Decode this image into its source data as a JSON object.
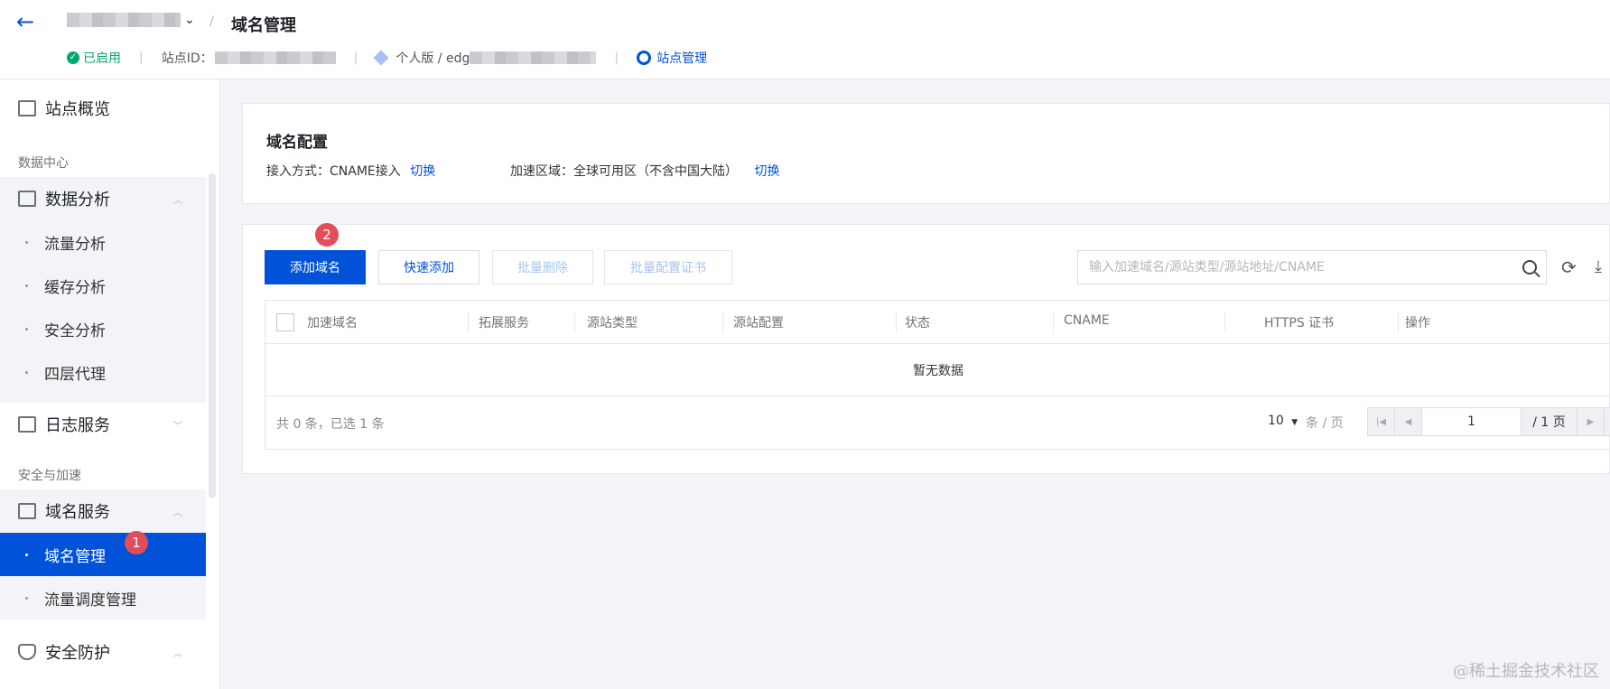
{
  "header": {
    "page_title": "域名管理",
    "breadcrumb_sep": "/",
    "status": "已启用",
    "site_id_label": "站点ID：",
    "edition": "个人版 / edg",
    "site_manage": "站点管理"
  },
  "sidebar": {
    "overview": "站点概览",
    "group_data": "数据中心",
    "data_analysis": "数据分析",
    "sub_data": [
      "流量分析",
      "缓存分析",
      "安全分析",
      "四层代理"
    ],
    "log_service": "日志服务",
    "group_security": "安全与加速",
    "domain_service": "域名服务",
    "sub_domain": [
      "域名管理",
      "流量调度管理"
    ],
    "security": "安全防护",
    "badge_1": "1"
  },
  "config": {
    "title": "域名配置",
    "access_label": "接入方式：CNAME接入",
    "access_switch": "切换",
    "region_label": "加速区域：全球可用区（不含中国大陆）",
    "region_switch": "切换"
  },
  "toolbar": {
    "add_domain": "添加域名",
    "quick_add": "快速添加",
    "batch_delete": "批量删除",
    "batch_cert": "批量配置证书",
    "search_placeholder": "输入加速域名/源站类型/源站地址/CNAME",
    "badge_2": "2"
  },
  "table": {
    "columns": [
      "加速域名",
      "拓展服务",
      "源站类型",
      "源站配置",
      "状态",
      "CNAME",
      "HTTPS 证书",
      "操作"
    ],
    "empty_text": "暂无数据"
  },
  "footer": {
    "total": "共 0 条，已选 1 条",
    "page_size": "10",
    "page_size_unit": "条 / 页",
    "current_page": "1",
    "total_pages": "/ 1 页"
  },
  "watermark": "@稀土掘金技术社区",
  "colors": {
    "primary": "#0052d9",
    "success": "#00a870",
    "badge": "#e34d59"
  }
}
